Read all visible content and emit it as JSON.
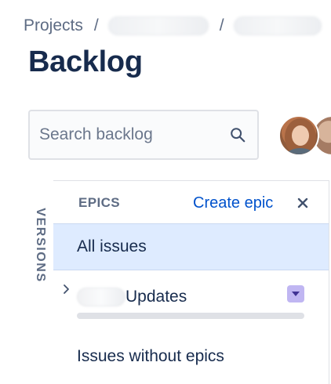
{
  "breadcrumb": {
    "projects_label": "Projects",
    "separator": "/"
  },
  "page": {
    "title": "Backlog"
  },
  "search": {
    "placeholder": "Search backlog",
    "value": ""
  },
  "versions_tab": {
    "label": "VERSIONS"
  },
  "epics_panel": {
    "title": "EPICS",
    "create_label": "Create epic",
    "close_glyph": "✕",
    "all_issues_label": "All issues",
    "epics": [
      {
        "name_suffix": "Updates",
        "lozenge_color": "#C0B6F2",
        "progress": 0
      }
    ],
    "issues_without_epics_label": "Issues without epics"
  },
  "colors": {
    "accent": "#0052CC",
    "selected_bg": "#DEEBFF",
    "text": "#172B4D",
    "muted": "#5E6C84"
  },
  "icons": {
    "search": "search-icon",
    "close": "close-icon",
    "chevron": "chevron-right-icon",
    "epic_caret": "chevron-down-icon"
  }
}
